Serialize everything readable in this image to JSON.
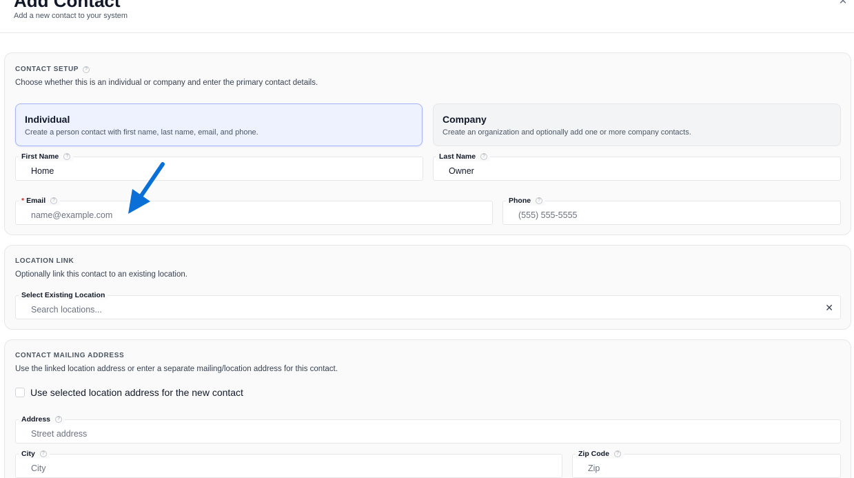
{
  "header": {
    "title": "Add Contact",
    "subtitle": "Add a new contact to your system",
    "close_icon": "close-icon"
  },
  "contact_setup": {
    "title": "CONTACT SETUP",
    "description": "Choose whether this is an individual or company and enter the primary contact details.",
    "options": [
      {
        "title": "Individual",
        "description": "Create a person contact with first name, last name, email, and phone.",
        "selected": true
      },
      {
        "title": "Company",
        "description": "Create an organization and optionally add one or more company contacts.",
        "selected": false
      }
    ],
    "first_name": {
      "label": "First Name",
      "value": "Home",
      "placeholder": ""
    },
    "last_name": {
      "label": "Last Name",
      "value": "Owner",
      "placeholder": ""
    },
    "email": {
      "label": "Email",
      "required_mark": "*",
      "value": "",
      "placeholder": "name@example.com"
    },
    "phone": {
      "label": "Phone",
      "value": "",
      "placeholder": "(555) 555-5555"
    }
  },
  "location_link": {
    "title": "LOCATION LINK",
    "description": "Optionally link this contact to an existing location.",
    "select": {
      "label": "Select Existing Location",
      "value": "",
      "placeholder": "Search locations...",
      "clear_icon": "close-icon"
    }
  },
  "mailing_address": {
    "title": "CONTACT MAILING ADDRESS",
    "description": "Use the linked location address or enter a separate mailing/location address for this contact.",
    "use_location_checkbox": {
      "label": "Use selected location address for the new contact",
      "checked": false
    },
    "address": {
      "label": "Address",
      "value": "",
      "placeholder": "Street address"
    },
    "city": {
      "label": "City",
      "value": "",
      "placeholder": "City"
    },
    "zip": {
      "label": "Zip Code",
      "value": "",
      "placeholder": "Zip"
    }
  },
  "annotation": {
    "arrow_color": "#0a6fd6",
    "icon": "arrow-icon"
  },
  "colors": {
    "accent_border": "#a5b4fc",
    "accent_bg": "#eef2ff",
    "required": "#dc2626"
  }
}
